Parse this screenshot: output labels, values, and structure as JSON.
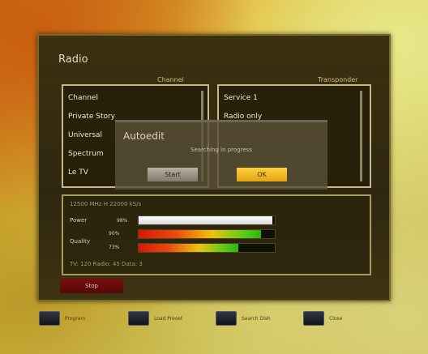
{
  "screen": {
    "title": "Radio",
    "lists": {
      "left_label": "Channel",
      "right_label": "Transponder",
      "left_items": [
        "Channel",
        "Private Story",
        "Universal",
        "Spectrum",
        "Le TV"
      ],
      "right_items": [
        "Service 1",
        "Radio only"
      ]
    }
  },
  "dialog": {
    "title": "Autoedit",
    "message": "Searching in progress",
    "button_left": "Start",
    "button_right": "OK"
  },
  "signal": {
    "info": "12500 MHz  H  22000 kS/s",
    "power_label": "Power",
    "power_value": "98%",
    "power_level": 0.98,
    "quality_label": "Quality",
    "quality_row1_value": "90%",
    "quality_row1_level": 0.9,
    "quality_row2_value": "73%",
    "quality_row2_level": 0.73,
    "footer_info": "TV: 120  Radio: 45  Data: 3",
    "stop_button": "Stop"
  },
  "footer": {
    "keys": [
      "Program",
      "Load Preset",
      "Search Dish",
      "Close"
    ]
  },
  "colors": {
    "accent_yellow": "#f2b81e",
    "stop_red": "#6a0b0a",
    "frame_orange": "#c95e10"
  }
}
